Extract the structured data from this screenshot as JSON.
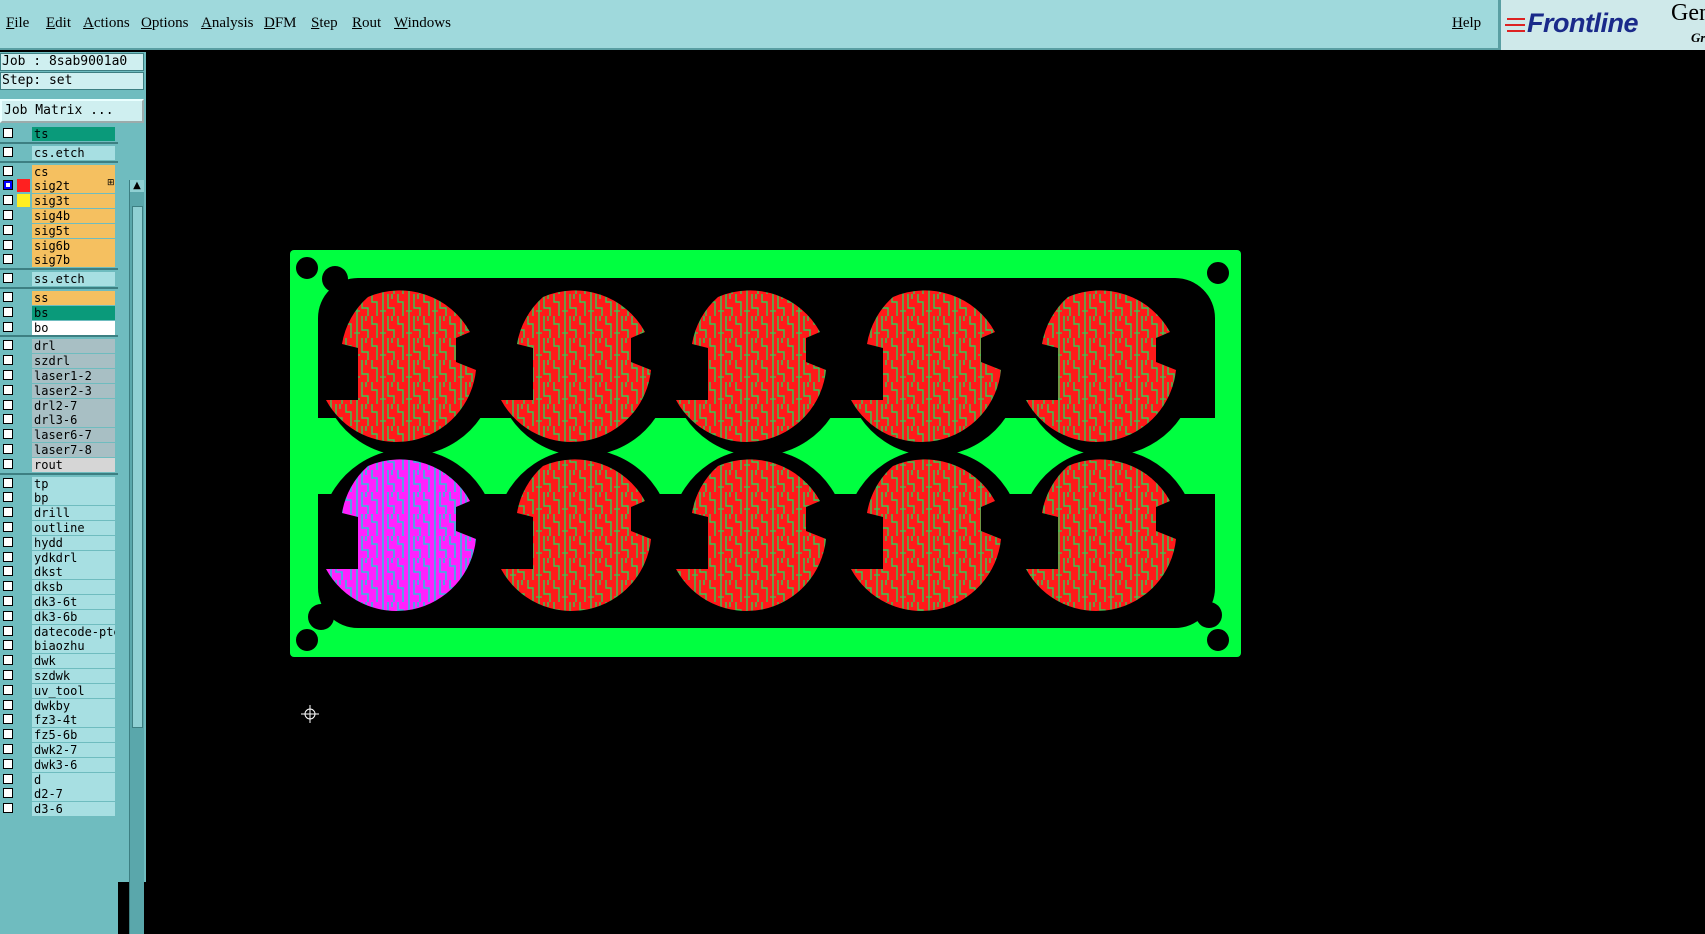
{
  "menu": [
    "File",
    "Edit",
    "Actions",
    "Options",
    "Analysis",
    "DFM",
    "Step",
    "Rout",
    "Windows"
  ],
  "help": "Help",
  "logo": {
    "brand": "Frontline",
    "gen": "Gen",
    "sub": "Gr"
  },
  "job": "Job : 8sab9001a0",
  "step": "Step: set",
  "job_matrix": "Job Matrix ...",
  "layers": [
    {
      "name": "ts",
      "kind": "ts"
    },
    {
      "name": "cs.etch",
      "kind": "misc"
    },
    {
      "name": "cs",
      "kind": "board"
    },
    {
      "name": "sig2t",
      "kind": "board",
      "checked": true,
      "color": "#ff2020",
      "mark": "⊞"
    },
    {
      "name": "sig3t",
      "kind": "board",
      "color": "#ffee20"
    },
    {
      "name": "sig4b",
      "kind": "board"
    },
    {
      "name": "sig5t",
      "kind": "board"
    },
    {
      "name": "sig6b",
      "kind": "board"
    },
    {
      "name": "sig7b",
      "kind": "board"
    },
    {
      "name": "ss.etch",
      "kind": "misc"
    },
    {
      "name": "ss",
      "kind": "board"
    },
    {
      "name": "bs",
      "kind": "ts"
    },
    {
      "name": "bo",
      "kind": "bo"
    },
    {
      "name": "drl",
      "kind": "drill"
    },
    {
      "name": "szdrl",
      "kind": "drill"
    },
    {
      "name": "laser1-2",
      "kind": "drill"
    },
    {
      "name": "laser2-3",
      "kind": "drill"
    },
    {
      "name": "drl2-7",
      "kind": "drill"
    },
    {
      "name": "drl3-6",
      "kind": "drill"
    },
    {
      "name": "laser6-7",
      "kind": "drill"
    },
    {
      "name": "laser7-8",
      "kind": "drill"
    },
    {
      "name": "rout",
      "kind": "rout"
    },
    {
      "name": "tp",
      "kind": "misc"
    },
    {
      "name": "bp",
      "kind": "misc"
    },
    {
      "name": "drill",
      "kind": "misc"
    },
    {
      "name": "outline",
      "kind": "misc"
    },
    {
      "name": "hydd",
      "kind": "misc"
    },
    {
      "name": "ydkdrl",
      "kind": "misc"
    },
    {
      "name": "dkst",
      "kind": "misc"
    },
    {
      "name": "dksb",
      "kind": "misc"
    },
    {
      "name": "dk3-6t",
      "kind": "misc"
    },
    {
      "name": "dk3-6b",
      "kind": "misc"
    },
    {
      "name": "datecode-pte",
      "kind": "misc"
    },
    {
      "name": "biaozhu",
      "kind": "misc"
    },
    {
      "name": "dwk",
      "kind": "misc"
    },
    {
      "name": "szdwk",
      "kind": "misc"
    },
    {
      "name": "uv_tool",
      "kind": "misc"
    },
    {
      "name": "dwkby",
      "kind": "misc"
    },
    {
      "name": "fz3-4t",
      "kind": "misc"
    },
    {
      "name": "fz5-6b",
      "kind": "misc"
    },
    {
      "name": "dwk2-7",
      "kind": "misc"
    },
    {
      "name": "dwk3-6",
      "kind": "misc"
    },
    {
      "name": "d",
      "kind": "misc"
    },
    {
      "name": "d2-7",
      "kind": "misc"
    },
    {
      "name": "d3-6",
      "kind": "misc"
    }
  ],
  "colors": {
    "panel": "#00ff40",
    "circuit": "#ff1a1a",
    "highlight": "#ff22ff",
    "trace": "#33cc55"
  }
}
